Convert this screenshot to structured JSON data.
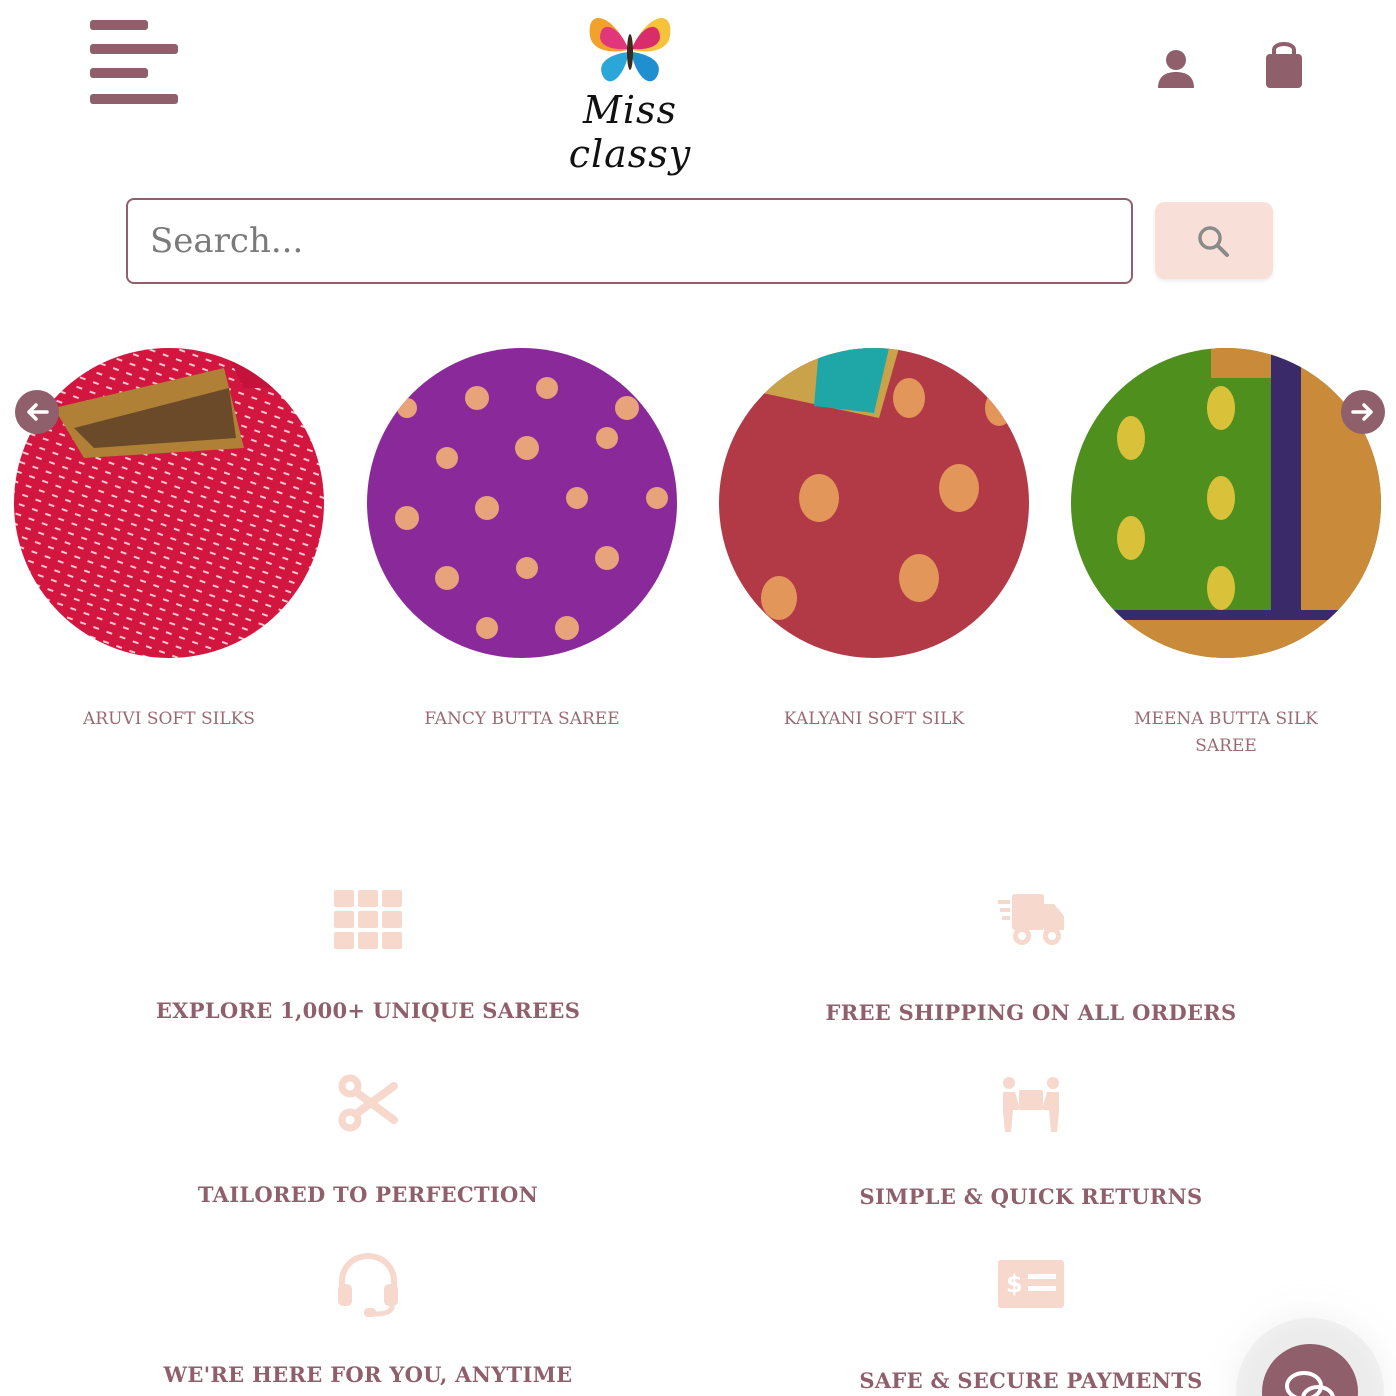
{
  "header": {
    "menu_icon": "hamburger-menu-icon",
    "logo_text": "Miss classy",
    "user_icon": "user-icon",
    "cart_icon": "shopping-bag-icon"
  },
  "search": {
    "placeholder": "Search...",
    "button_icon": "search-icon"
  },
  "categories": [
    {
      "label": "ARUVI SOFT SILKS",
      "color": "#d2163f"
    },
    {
      "label": "FANCY BUTTA SAREE",
      "color": "#8a2a9a"
    },
    {
      "label": "KALYANI SOFT SILK",
      "color": "#b23a46"
    },
    {
      "label": "MEENA BUTTA SILK SAREE",
      "color": "#4f8f1d"
    }
  ],
  "carousel": {
    "prev_icon": "arrow-left-icon",
    "next_icon": "arrow-right-icon"
  },
  "features": [
    {
      "icon": "grid-icon",
      "text": "EXPLORE 1,000+ UNIQUE SAREES"
    },
    {
      "icon": "truck-icon",
      "text": "FREE SHIPPING ON ALL ORDERS"
    },
    {
      "icon": "scissors-icon",
      "text": "TAILORED TO PERFECTION"
    },
    {
      "icon": "people-carry-icon",
      "text": "SIMPLE & QUICK RETURNS"
    },
    {
      "icon": "headset-icon",
      "text": "WE'RE HERE FOR YOU, ANYTIME"
    },
    {
      "icon": "money-check-icon",
      "text": "SAFE & SECURE PAYMENTS"
    }
  ],
  "chat": {
    "icon": "chat-icon"
  },
  "colors": {
    "brand": "#8f5f6b",
    "accent_light": "#f8e0d8",
    "feature_icon": "#f6d8cc"
  }
}
